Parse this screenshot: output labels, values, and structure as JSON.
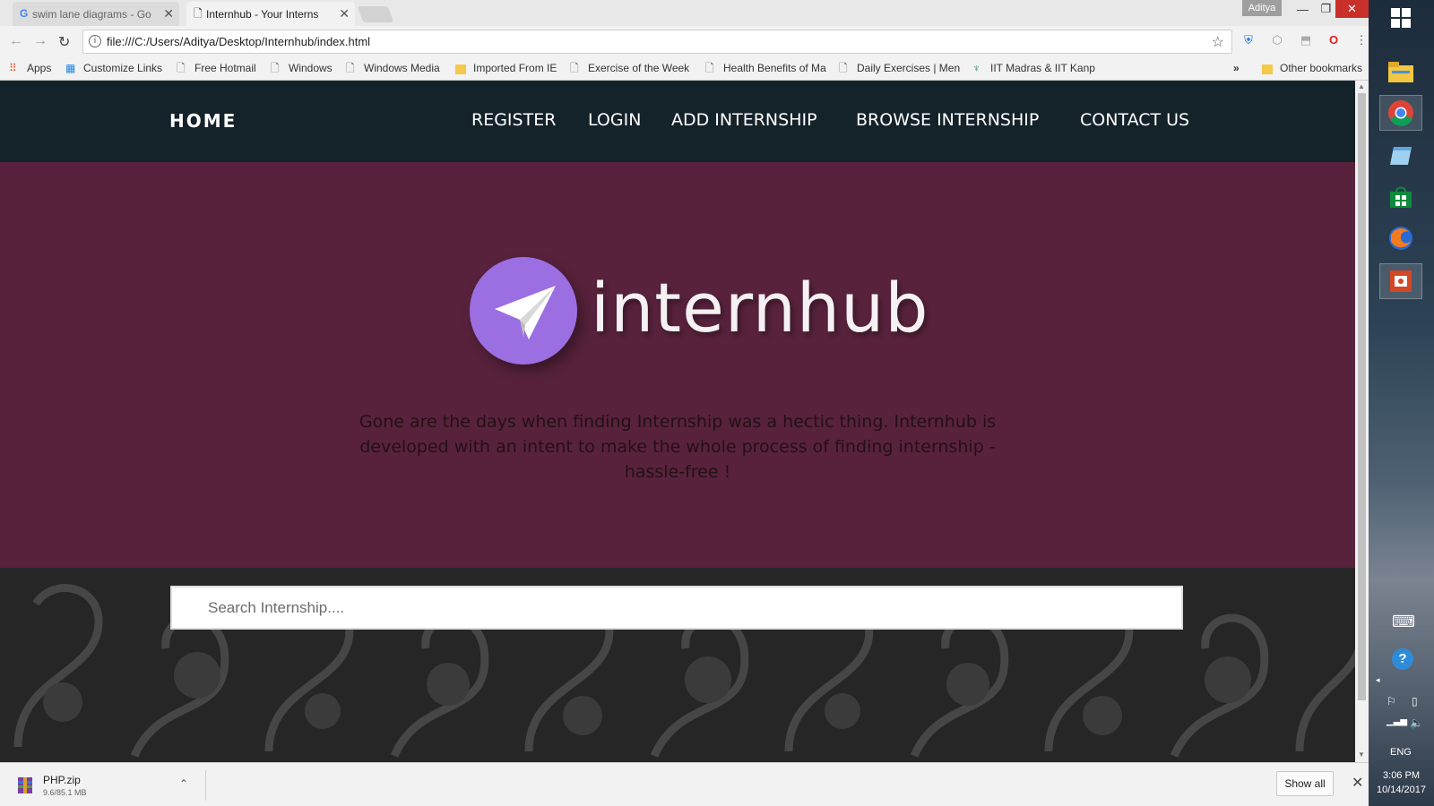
{
  "browser": {
    "tabs": [
      {
        "title": "swim lane diagrams - Go",
        "active": false
      },
      {
        "title": "Internhub - Your Interns",
        "active": true
      }
    ],
    "user": "Aditya",
    "url": "file:///C:/Users/Aditya/Desktop/Internhub/index.html",
    "bookmarks": [
      {
        "label": "Apps",
        "icon": "apps-grid-icon"
      },
      {
        "label": "Customize Links",
        "icon": "windows-flag-icon"
      },
      {
        "label": "Free Hotmail",
        "icon": "page-icon"
      },
      {
        "label": "Windows",
        "icon": "page-icon"
      },
      {
        "label": "Windows Media",
        "icon": "page-icon"
      },
      {
        "label": "Imported From IE",
        "icon": "folder-icon"
      },
      {
        "label": "Exercise of the Week",
        "icon": "page-icon"
      },
      {
        "label": "Health Benefits of Ma",
        "icon": "page-icon"
      },
      {
        "label": "Daily Exercises | Men",
        "icon": "page-icon"
      },
      {
        "label": "IIT Madras & IIT Kanp",
        "icon": "iit-logo-icon"
      }
    ],
    "bookmarks_overflow": "»",
    "other_bookmarks": "Other bookmarks"
  },
  "site": {
    "nav": {
      "home": "HOME",
      "links": [
        "REGISTER",
        "LOGIN",
        "ADD INTERNSHIP",
        "BROWSE INTERNSHIP",
        "CONTACT US"
      ]
    },
    "logo_text": "internhub",
    "tagline": "Gone are the days when finding Internship was a hectic thing. Internhub is developed with an intent to make the whole process of finding internship - hassle-free !",
    "search_placeholder": "Search Internship....",
    "colors": {
      "nav_bg": "#14222a",
      "hero_bg": "#58223c",
      "logo_circle": "#9b6ee2"
    }
  },
  "downloads": {
    "file_name": "PHP.zip",
    "file_progress": "9.6/85.1 MB",
    "show_all": "Show all"
  },
  "taskbar": {
    "language": "ENG",
    "time": "3:06 PM",
    "date": "10/14/2017"
  }
}
